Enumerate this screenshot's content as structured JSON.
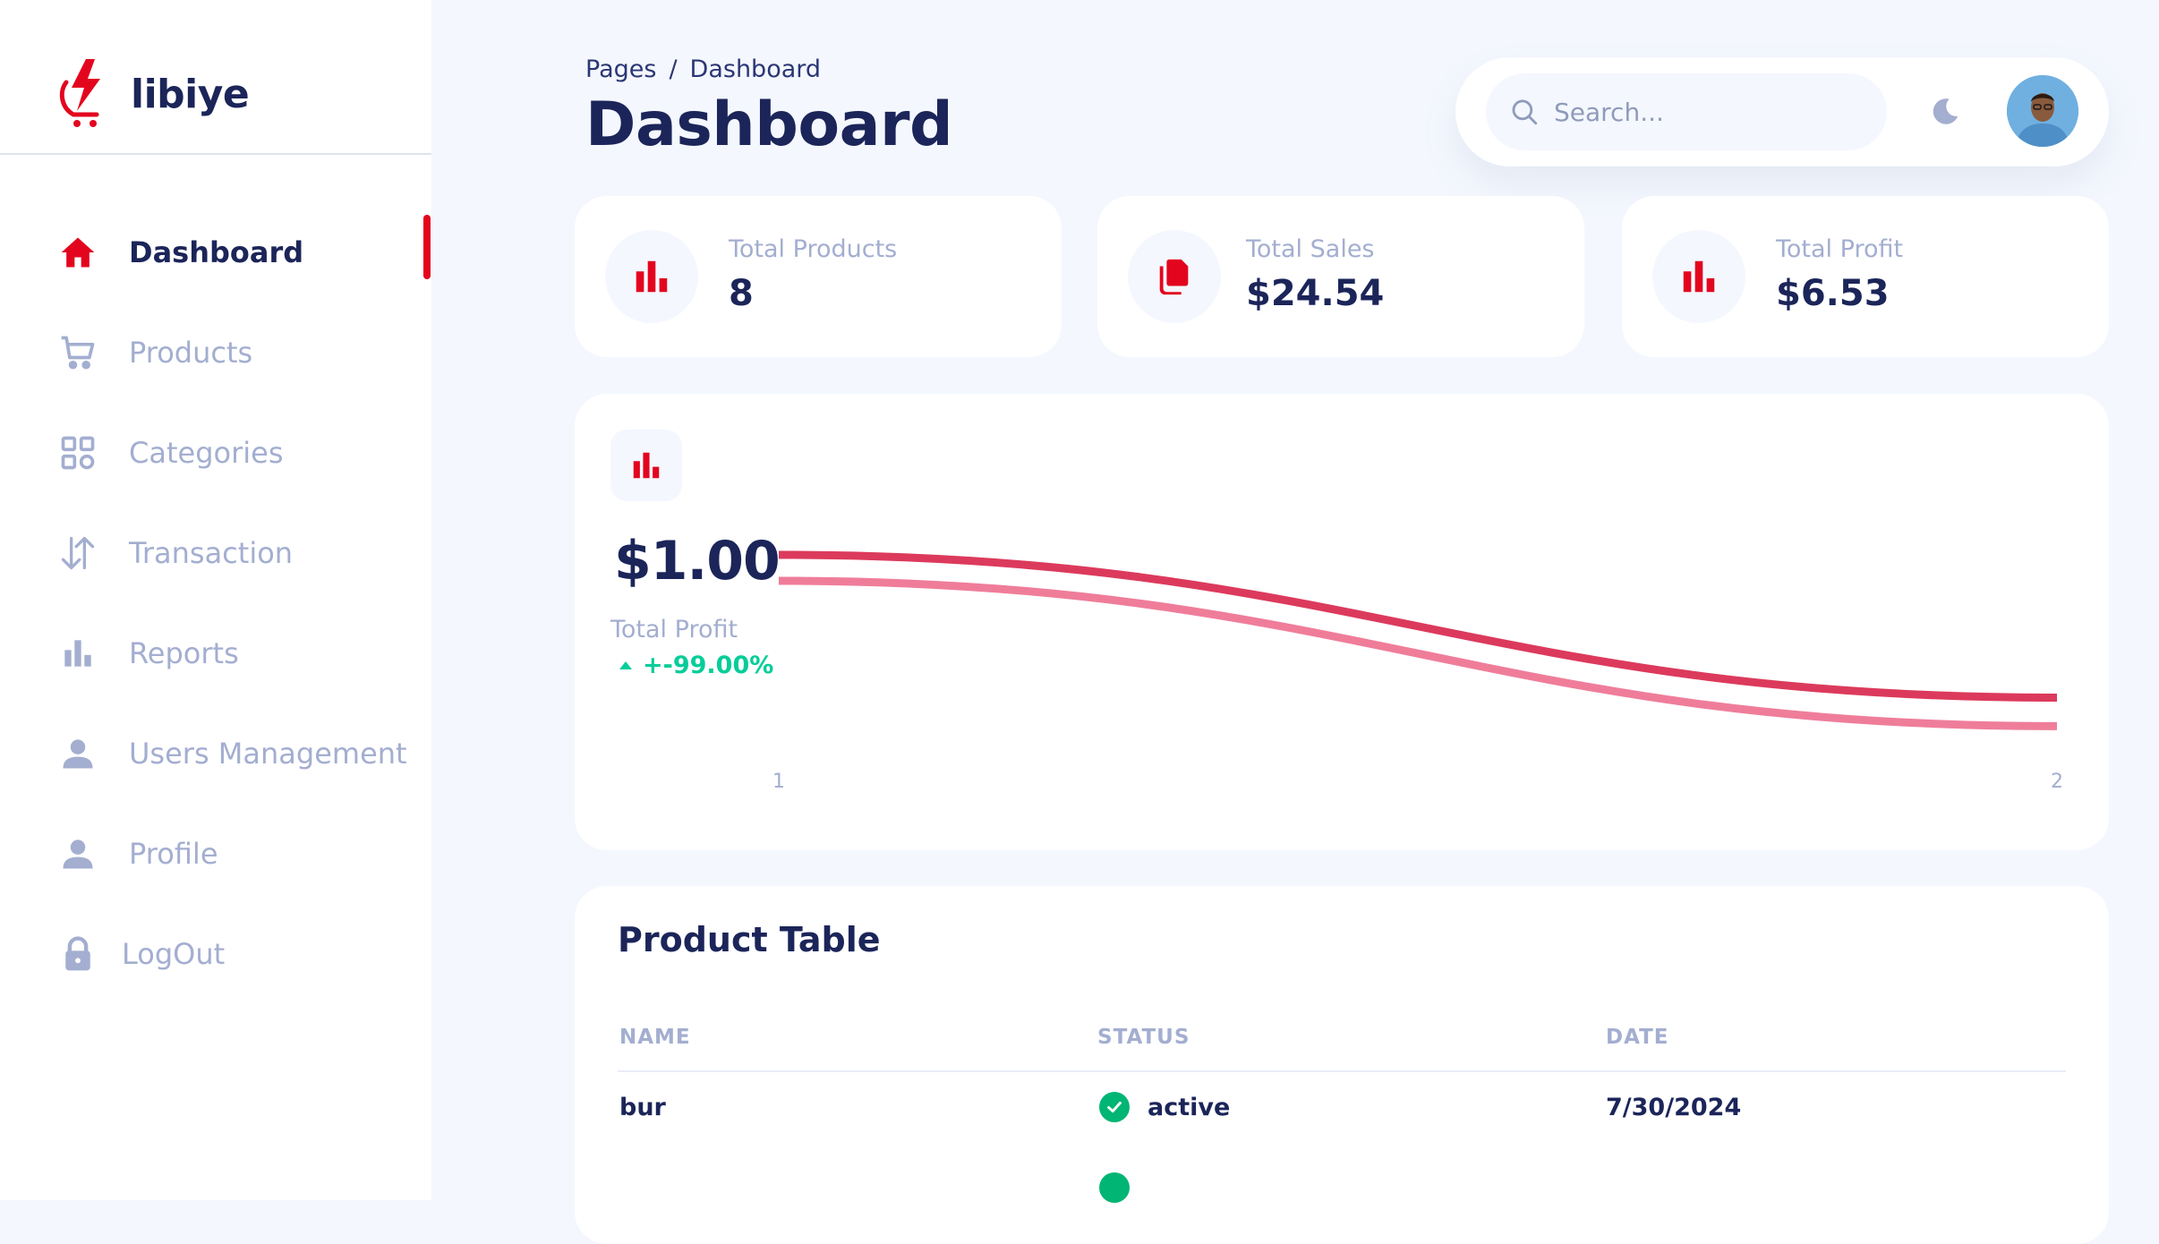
{
  "brand": {
    "name": "libiye"
  },
  "sidebar": {
    "items": [
      {
        "label": "Dashboard",
        "icon": "home-icon",
        "active": true
      },
      {
        "label": "Products",
        "icon": "cart-icon"
      },
      {
        "label": "Categories",
        "icon": "grid-icon"
      },
      {
        "label": "Transaction",
        "icon": "arrows-updown-icon"
      },
      {
        "label": "Reports",
        "icon": "bar-chart-icon"
      },
      {
        "label": "Users Management",
        "icon": "person-icon"
      },
      {
        "label": "Profile",
        "icon": "person-icon"
      },
      {
        "label": "LogOut",
        "icon": "lock-icon"
      }
    ]
  },
  "header": {
    "breadcrumb": {
      "root": "Pages",
      "separator": "/",
      "current": "Dashboard"
    },
    "title": "Dashboard",
    "search": {
      "placeholder": "Search..."
    }
  },
  "stats": [
    {
      "label": "Total Products",
      "value": "8",
      "icon": "bar-chart-icon"
    },
    {
      "label": "Total Sales",
      "value": "$24.54",
      "icon": "documents-icon"
    },
    {
      "label": "Total Profit",
      "value": "$6.53",
      "icon": "bar-chart-icon"
    }
  ],
  "profit_chart": {
    "value": "$1.00",
    "label": "Total Profit",
    "change": "+-99.00%"
  },
  "chart_data": {
    "type": "line",
    "x": [
      "1",
      "2"
    ],
    "series": [
      {
        "values": [
          1.0,
          0.45
        ],
        "color": "#dc3a5c"
      },
      {
        "values": [
          0.9,
          0.34
        ],
        "color": "#ef7d9a"
      }
    ],
    "grid": false
  },
  "table": {
    "title": "Product Table",
    "columns": [
      "NAME",
      "STATUS",
      "DATE"
    ],
    "rows": [
      {
        "name": "bur",
        "status": "active",
        "date": "7/30/2024"
      },
      {
        "name": "",
        "status": "",
        "date": ""
      }
    ]
  },
  "colors": {
    "accent": "#e3051e",
    "text": "#1b2559",
    "muted": "#a3aed0",
    "positive": "#05cd99",
    "background": "#f4f7fe"
  }
}
